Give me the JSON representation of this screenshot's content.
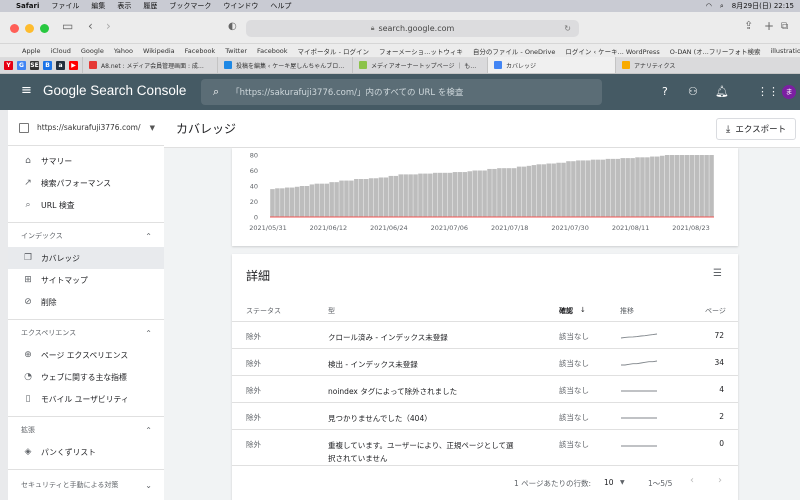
{
  "mac_menubar": {
    "app": "Safari",
    "items": [
      "ファイル",
      "編集",
      "表示",
      "履歴",
      "ブックマーク",
      "ウインドウ",
      "ヘルプ"
    ],
    "datetime": "8月29日(日)  22:15"
  },
  "browser": {
    "url": "search.google.com",
    "bookmarks": [
      "Apple",
      "iCloud",
      "Google",
      "Yahoo",
      "Wikipedia",
      "Facebook",
      "Twitter",
      "Facebook",
      "マイポータル - ログイン",
      "フォーメーショ...ットウィキ",
      "自分のファイル - OneDrive",
      "ログイン ‹ ケーキ... WordPress",
      "O-DAN (オ...フリーフォト検索",
      "illustrations | unDraw"
    ],
    "pinned_tabs": [
      {
        "letter": "Y",
        "color": "#e60012"
      },
      {
        "letter": "G",
        "color": "#4285f4"
      },
      {
        "letter": "SE",
        "color": "#333333"
      },
      {
        "letter": "B",
        "color": "#1a73e8"
      },
      {
        "letter": "a",
        "color": "#232f3e"
      },
      {
        "letter": "▶",
        "color": "#ff0000"
      }
    ],
    "tabs": [
      {
        "label": "A8.net : メディア会員管理画面 : 成…",
        "color": "#e53935",
        "active": false
      },
      {
        "label": "投稿を編集 ‹ ケーキ屋しんちゃんブロ…",
        "color": "#1e88e5",
        "active": false
      },
      {
        "label": "メディアオーナートップページ ｜ も…",
        "color": "#8bc34a",
        "active": false
      },
      {
        "label": "カバレッジ",
        "color": "#4285f4",
        "active": true
      },
      {
        "label": "アナリティクス",
        "color": "#f9ab00",
        "active": false
      }
    ]
  },
  "header": {
    "brand": "Google Search Console",
    "search_placeholder": "「https://sakurafuji3776.com/」内のすべての URL を検査",
    "avatar_letter": "ま"
  },
  "sidebar": {
    "property": "https://sakurafuji3776.com/",
    "items_top": [
      {
        "label": "サマリー",
        "icon": "home-icon"
      },
      {
        "label": "検索パフォーマンス",
        "icon": "trending-icon"
      },
      {
        "label": "URL 検査",
        "icon": "search-icon"
      }
    ],
    "section_index": "インデックス",
    "items_index": [
      {
        "label": "カバレッジ",
        "icon": "file-copy-icon",
        "active": true
      },
      {
        "label": "サイトマップ",
        "icon": "sitemap-icon",
        "active": false
      },
      {
        "label": "削除",
        "icon": "visibility-off-icon",
        "active": false
      }
    ],
    "section_experience": "エクスペリエンス",
    "items_experience": [
      {
        "label": "ページ エクスペリエンス",
        "icon": "experience-icon"
      },
      {
        "label": "ウェブに関する主な指標",
        "icon": "speed-icon"
      },
      {
        "label": "モバイル ユーザビリティ",
        "icon": "phone-icon"
      }
    ],
    "section_enhance": "拡張",
    "items_enhance": [
      {
        "label": "パンくずリスト",
        "icon": "breadcrumb-icon"
      }
    ],
    "section_security": "セキュリティと手動による対策"
  },
  "page": {
    "title": "カバレッジ",
    "export_label": "エクスポート"
  },
  "chart_data": {
    "type": "bar",
    "y_ticks": [
      0,
      20,
      40,
      60,
      80
    ],
    "ylim": [
      0,
      80
    ],
    "x_labels": [
      "2021/05/31",
      "2021/06/12",
      "2021/06/24",
      "2021/07/06",
      "2021/07/18",
      "2021/07/30",
      "2021/08/11",
      "2021/08/23"
    ],
    "values": [
      36,
      37,
      37,
      38,
      38,
      39,
      40,
      40,
      42,
      43,
      43,
      43,
      45,
      45,
      47,
      47,
      47,
      49,
      49,
      49,
      50,
      50,
      51,
      51,
      53,
      53,
      55,
      55,
      55,
      55,
      56,
      56,
      56,
      57,
      57,
      57,
      57,
      58,
      58,
      58,
      59,
      60,
      60,
      60,
      62,
      62,
      63,
      63,
      63,
      63,
      65,
      65,
      66,
      67,
      68,
      68,
      69,
      69,
      70,
      70,
      72,
      72,
      73,
      73,
      73,
      74,
      74,
      74,
      75,
      75,
      75,
      76,
      76,
      76,
      77,
      77,
      77,
      78,
      78,
      79,
      80,
      80,
      80,
      80,
      80,
      80,
      80,
      80,
      80,
      80
    ],
    "bar_color": "#bdbdbd",
    "baseline_color": "#ef5350"
  },
  "details": {
    "title": "詳細",
    "columns": {
      "status": "ステータス",
      "type": "型",
      "confirm": "確認",
      "trend": "推移",
      "pages": "ページ"
    },
    "rows": [
      {
        "status": "除外",
        "type": "クロール済み - インデックス未登録",
        "confirm": "該当なし",
        "pages": "72",
        "trend": [
          58,
          60,
          61,
          62,
          63,
          65,
          66,
          68,
          70,
          72
        ]
      },
      {
        "status": "除外",
        "type": "検出 - インデックス未登録",
        "confirm": "該当なし",
        "pages": "34",
        "trend": [
          28,
          28,
          29,
          30,
          30,
          31,
          32,
          33,
          33,
          34
        ]
      },
      {
        "status": "除外",
        "type": "noindex タグによって除外されました",
        "confirm": "該当なし",
        "pages": "4",
        "trend": [
          4,
          4,
          4,
          4,
          4,
          4,
          4,
          4,
          4,
          4
        ]
      },
      {
        "status": "除外",
        "type": "見つかりませんでした（404）",
        "confirm": "該当なし",
        "pages": "2",
        "trend": [
          2,
          2,
          2,
          2,
          2,
          2,
          2,
          2,
          2,
          2
        ]
      },
      {
        "status": "除外",
        "type": "重複しています。ユーザーにより、正規ページとして選",
        "type2": "択されていません",
        "confirm": "該当なし",
        "pages": "0",
        "trend": [
          0,
          0,
          0,
          0,
          0,
          0,
          0,
          0,
          0,
          0
        ]
      }
    ],
    "pager": {
      "rows_label": "1 ページあたりの行数:",
      "rows_value": "10",
      "range": "1〜5/5"
    }
  }
}
